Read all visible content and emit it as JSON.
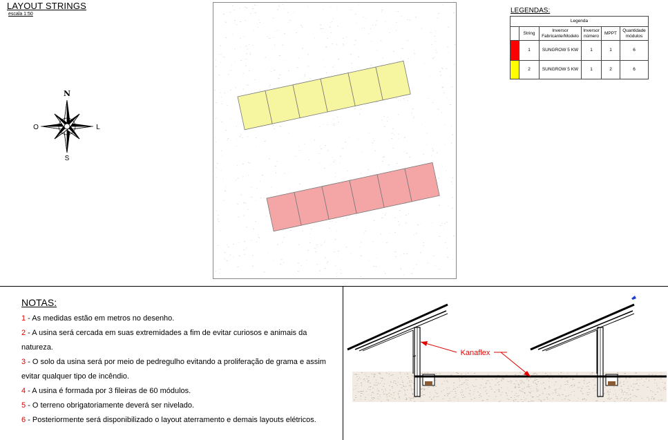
{
  "drawing": {
    "title": "LAYOUT STRINGS",
    "scale": "escala 1:50"
  },
  "compass": {
    "north": "N",
    "south": "S",
    "west": "O",
    "east": "L"
  },
  "legend": {
    "heading": "LEGENDAS:",
    "table_title": "Legenda",
    "headers": [
      "String",
      "Inversor Fabricante/Modelo",
      "Inversor número",
      "MPPT",
      "Quantidade módulos"
    ],
    "rows": [
      {
        "color": "#ff0000",
        "string": "1",
        "inverter": "SUNGROW 5 KW",
        "inverter_number": "1",
        "mppt": "1",
        "modules": "6"
      },
      {
        "color": "#ffff00",
        "string": "2",
        "inverter": "SUNGROW 5 KW",
        "inverter_number": "1",
        "mppt": "2",
        "modules": "6"
      }
    ]
  },
  "arrays": [
    {
      "name": "yellow-string",
      "fill": "#f6f6a0",
      "modules": 6
    },
    {
      "name": "red-string",
      "fill": "#f4a6a6",
      "modules": 6
    }
  ],
  "notes": {
    "title": "NOTAS:",
    "items": [
      {
        "num": "1",
        "text": " - As medidas estão em metros no desenho."
      },
      {
        "num": "2",
        "text": " - A usina será cercada em suas extremidades a fim de evitar curiosos e animais da natureza."
      },
      {
        "num": "3",
        "text": " - O solo da usina será por meio de pedregulho evitando a proliferação de grama e assim evitar qualquer tipo de incêndio."
      },
      {
        "num": "4",
        "text": " - A usina é formada por 3 fileiras de 60 módulos."
      },
      {
        "num": "5",
        "text": " - O terreno obrigatoriamente deverá ser nivelado."
      },
      {
        "num": "6",
        "text": " - Posteriormente será disponibilizado o layout aterramento e demais layouts elétricos."
      }
    ]
  },
  "section": {
    "cable_label": "Kanaflex"
  }
}
